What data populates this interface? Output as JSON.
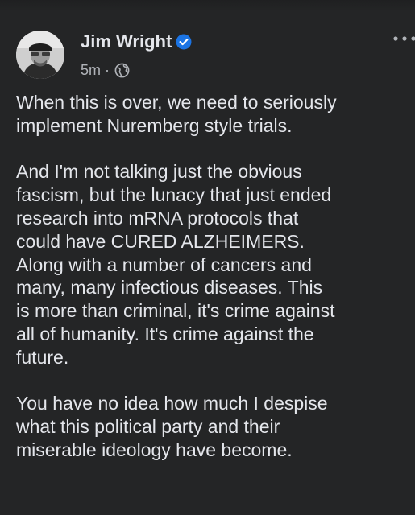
{
  "post": {
    "author": "Jim Wright",
    "timestamp": "5m",
    "separator": "·",
    "audience_icon": "globe-icon",
    "verified_icon": "verified-badge-icon",
    "more_icon": "more-options-icon",
    "paragraphs": [
      "When this is over, we need to seriously\nimplement Nuremberg style trials.",
      "And I'm not talking just the obvious\nfascism, but the lunacy that just ended\nresearch into mRNA protocols that\ncould have CURED ALZHEIMERS.\nAlong with a number of cancers and\nmany, many infectious diseases. This\nis more than criminal, it's crime against\nall of humanity. It's crime against the\nfuture.",
      "You have no idea how much I despise\nwhat this political party and their\nmiserable ideology have become."
    ]
  },
  "colors": {
    "background": "#242526",
    "primary_text": "#e4e6eb",
    "secondary_text": "#b0b3b8",
    "verified_blue": "#1b74e4"
  }
}
